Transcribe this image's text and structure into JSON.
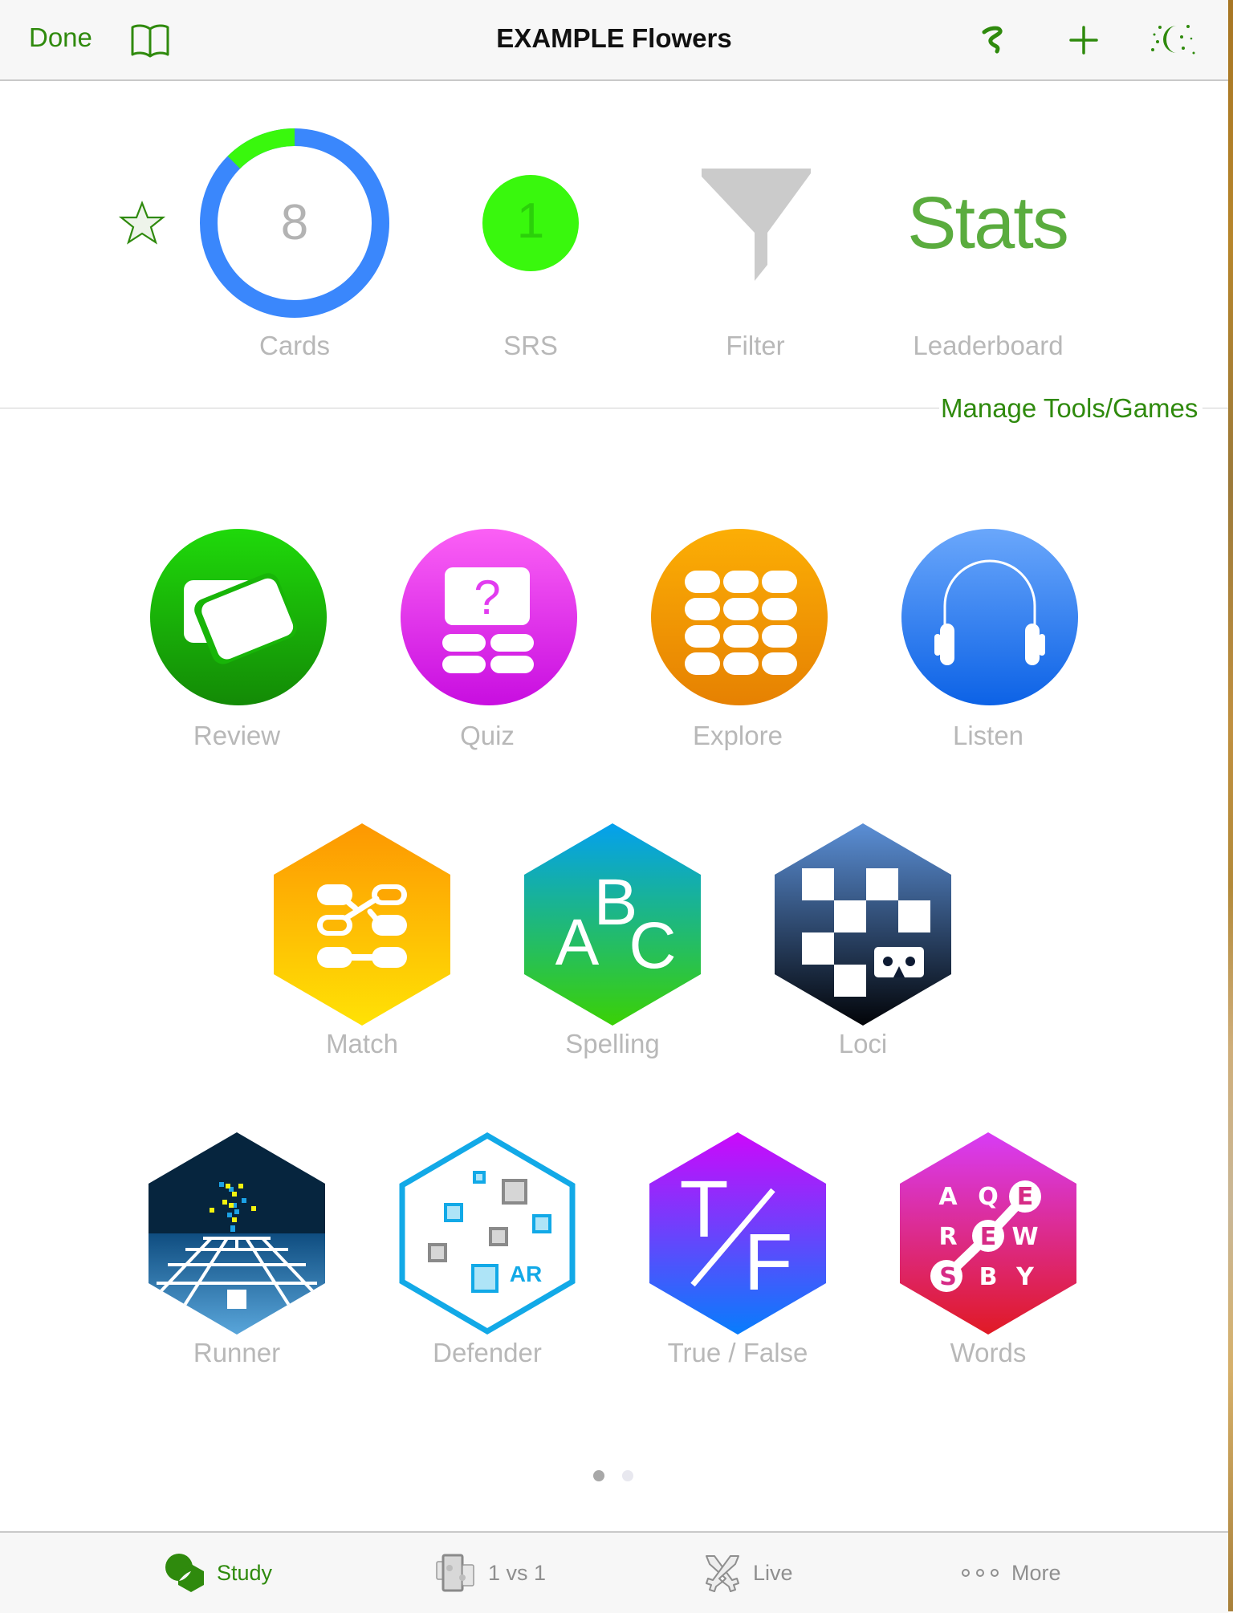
{
  "header": {
    "done_label": "Done",
    "title": "EXAMPLE Flowers",
    "icons": [
      "book-icon",
      "squiggle-icon",
      "plus-icon",
      "night-mode-icon"
    ]
  },
  "summary": {
    "favorite_icon": "star-icon",
    "cards": {
      "count": "8",
      "label": "Cards",
      "srs_fraction": 0.125
    },
    "srs": {
      "count": "1",
      "label": "SRS"
    },
    "filter": {
      "label": "Filter",
      "icon": "funnel-icon"
    },
    "leaderboard": {
      "big_text": "Stats",
      "label": "Leaderboard"
    },
    "colors": {
      "ring_blue": "#3a87fc",
      "ring_green": "#39f80d",
      "accent_green": "#2f8a0d"
    }
  },
  "manage_link": "Manage Tools/Games",
  "tools_row1": [
    {
      "label": "Review",
      "icon": "review-cards-icon",
      "color": "#1ec70a"
    },
    {
      "label": "Quiz",
      "icon": "quiz-icon",
      "color": "#e23cf0"
    },
    {
      "label": "Explore",
      "icon": "explore-grid-icon",
      "color": "#f79e05"
    },
    {
      "label": "Listen",
      "icon": "headphones-icon",
      "color": "#3a87fc"
    }
  ],
  "games_row2": [
    {
      "label": "Match",
      "icon": "match-icon"
    },
    {
      "label": "Spelling",
      "icon": "spelling-abc-icon",
      "letters": [
        "A",
        "B",
        "C"
      ]
    },
    {
      "label": "Loci",
      "icon": "loci-vr-icon"
    }
  ],
  "games_row3": [
    {
      "label": "Runner",
      "icon": "runner-icon"
    },
    {
      "label": "Defender",
      "icon": "defender-ar-icon",
      "badge": "AR"
    },
    {
      "label": "True / False",
      "icon": "true-false-icon",
      "letters": [
        "T",
        "F"
      ]
    },
    {
      "label": "Words",
      "icon": "words-grid-icon",
      "letters": [
        "A",
        "Q",
        "E",
        "R",
        "E",
        "W",
        "S",
        "B",
        "Y"
      ]
    }
  ],
  "pager": {
    "pages": 2,
    "current": 1
  },
  "tabs": [
    {
      "label": "Study",
      "icon": "study-icon",
      "active": true
    },
    {
      "label": "1 vs 1",
      "icon": "puzzle-icon",
      "active": false
    },
    {
      "label": "Live",
      "icon": "crossed-swords-icon",
      "active": false
    },
    {
      "label": "More",
      "icon": "more-dots-icon",
      "active": false
    }
  ]
}
